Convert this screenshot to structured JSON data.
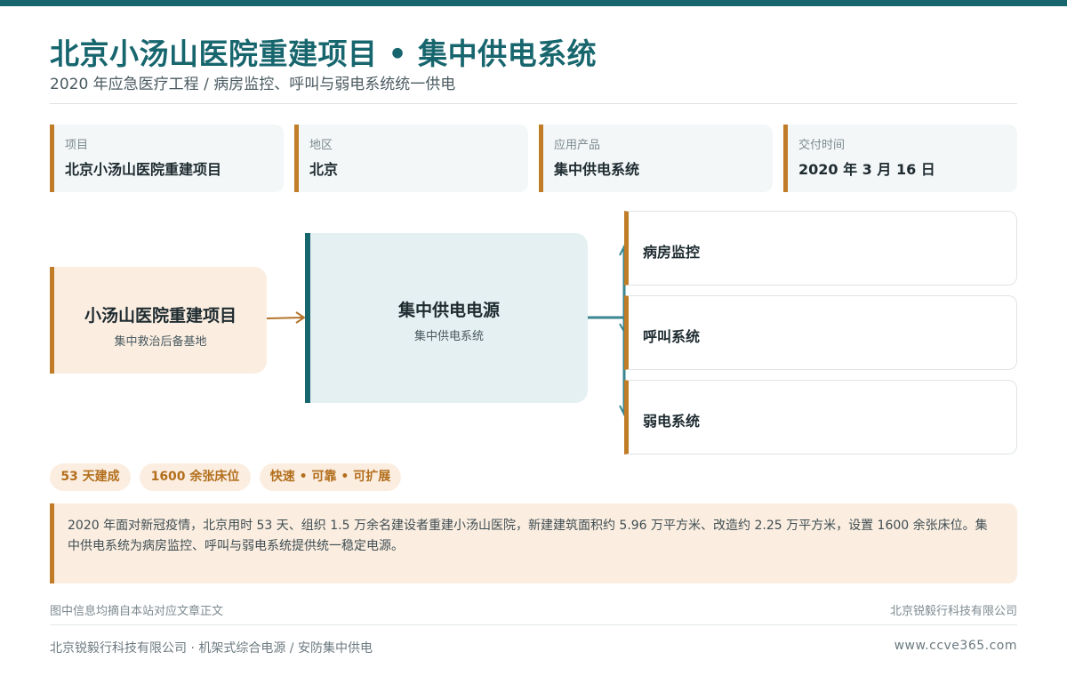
{
  "header": {
    "title": "北京小汤山医院重建项目 • 集中供电系统",
    "subtitle": "2020 年应急医疗工程 / 病房监控、呼叫与弱电系统统一供电"
  },
  "info_cards": [
    {
      "label": "项目",
      "value": "北京小汤山医院重建项目"
    },
    {
      "label": "地区",
      "value": "北京"
    },
    {
      "label": "应用产品",
      "value": "集中供电系统"
    },
    {
      "label": "交付时间",
      "value": "2020 年 3 月 16 日"
    }
  ],
  "diagram": {
    "source": {
      "title": "小汤山医院重建项目",
      "subtitle": "集中救治后备基地"
    },
    "center": {
      "title": "集中供电电源",
      "subtitle": "集中供电系统"
    },
    "targets": [
      "病房监控",
      "呼叫系统",
      "弱电系统"
    ]
  },
  "tags": [
    "53 天建成",
    "1600 余张床位",
    "快速 • 可靠 • 可扩展"
  ],
  "note": "2020 年面对新冠疫情，北京用时 53 天、组织 1.5 万余名建设者重建小汤山医院，新建建筑面积约 5.96 万平方米、改造约 2.25 万平方米，设置 1600 余张床位。集中供电系统为病房监控、呼叫与弱电系统提供统一稳定电源。",
  "footer": {
    "source_note": "图中信息均摘自本站对应文章正文",
    "company": "北京锐毅行科技有限公司",
    "tagline": "北京锐毅行科技有限公司 · 机架式综合电源 / 安防集中供电",
    "website": "www.ccve365.com"
  },
  "colors": {
    "primary": "#17666e",
    "accent": "#c07c26",
    "tag_bg": "#fbeee1",
    "center_bg": "#e5f0f2"
  }
}
